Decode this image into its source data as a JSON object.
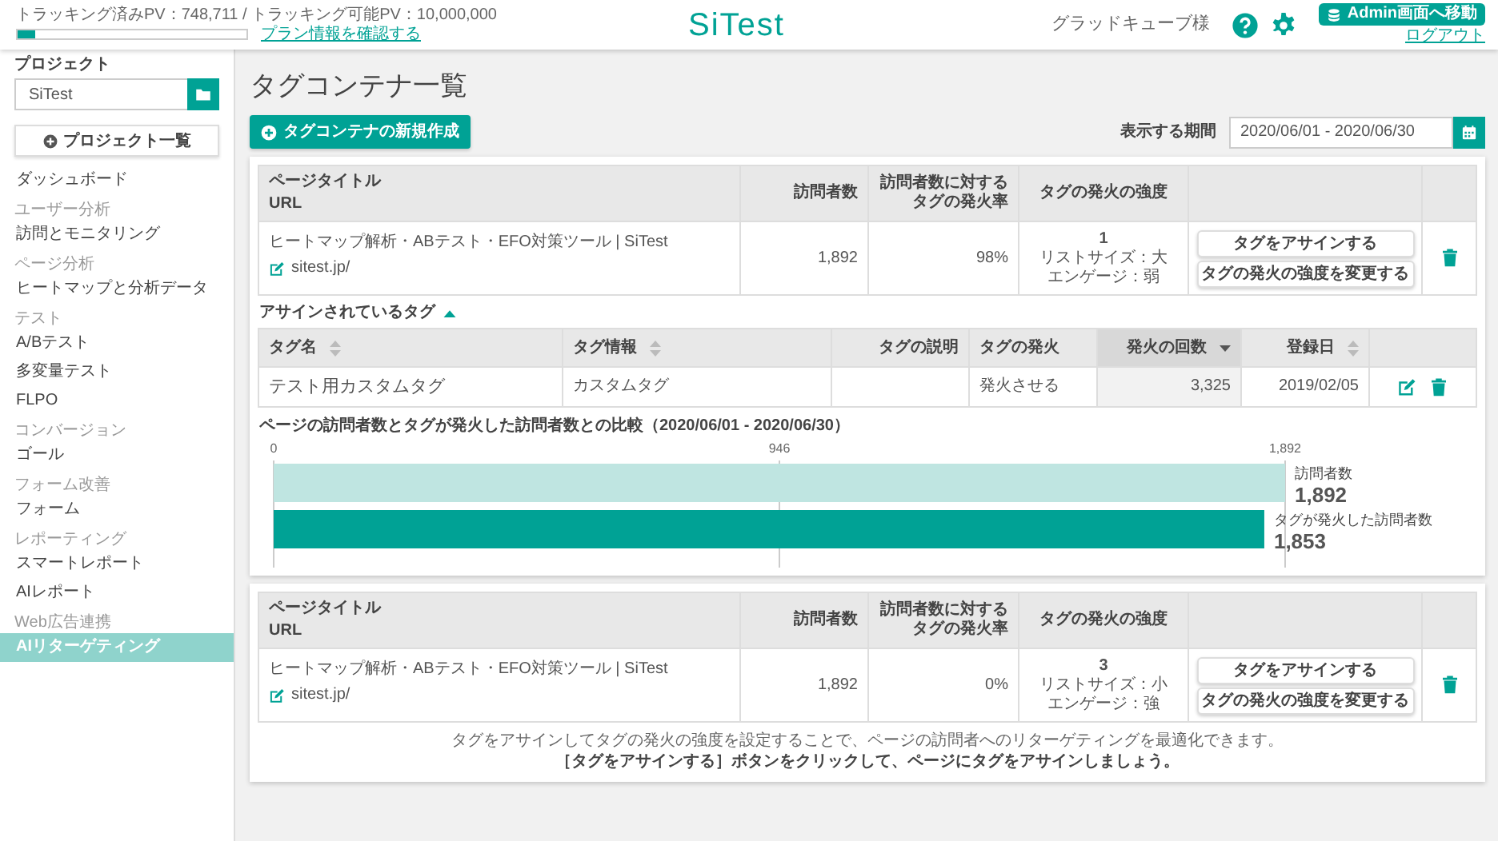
{
  "header": {
    "tracking_text": "トラッキング済みPV：748,711 / トラッキング可能PV：10,000,000",
    "usage": {
      "level": 0.075
    },
    "plan_link": "プラン情報を確認する",
    "logo": "SiTest",
    "user": "グラッドキューブ様",
    "admin_button": "Admin画面へ移動",
    "logout_link": "ログアウト"
  },
  "sidebar": {
    "project_label": "プロジェクト",
    "project_value": "SiTest",
    "project_list_button": "プロジェクト一覧",
    "sections": [
      {
        "items": [
          {
            "label": "ダッシュボード",
            "selected": false
          }
        ]
      },
      {
        "heading": "ユーザー分析",
        "items": [
          {
            "label": "訪問とモニタリング",
            "selected": false
          }
        ]
      },
      {
        "heading": "ページ分析",
        "items": [
          {
            "label": "ヒートマップと分析データ",
            "selected": false
          }
        ]
      },
      {
        "heading": "テスト",
        "items": [
          {
            "label": "A/Bテスト",
            "selected": false
          },
          {
            "label": "多変量テスト",
            "selected": false
          },
          {
            "label": "FLPO",
            "selected": false
          }
        ]
      },
      {
        "heading": "コンバージョン",
        "items": [
          {
            "label": "ゴール",
            "selected": false
          }
        ]
      },
      {
        "heading": "フォーム改善",
        "items": [
          {
            "label": "フォーム",
            "selected": false
          }
        ]
      },
      {
        "heading": "レポーティング",
        "items": [
          {
            "label": "スマートレポート",
            "selected": false
          },
          {
            "label": "AIレポート",
            "selected": false
          }
        ]
      },
      {
        "heading": "Web広告連携",
        "items": [
          {
            "label": "AIリターゲティング",
            "selected": true
          }
        ]
      }
    ]
  },
  "main": {
    "title": "タグコンテナ一覧",
    "new_button": "タグコンテナの新規作成",
    "period_label": "表示する期間",
    "period_value": "2020/06/01 - 2020/06/30",
    "pages": [
      {
        "columns": {
          "title": "ページタイトル",
          "url": "URL",
          "visitors": "訪問者数",
          "rate": [
            "訪問者数に対する",
            "タグの発火率"
          ],
          "strength": "タグの発火の強度"
        },
        "title": "ヒートマップ解析・ABテスト・EFO対策ツール | SiTest",
        "url": "sitest.jp/",
        "visitors": "1,892",
        "rate": "98%",
        "strength": "1",
        "list_size": "リストサイズ：大",
        "engagement": "エンゲージ：弱",
        "assign_button": "タグをアサインする",
        "change_button": "タグの発火の強度を変更する",
        "expanded": true,
        "assigned": {
          "label": "アサインされているタグ",
          "columns": [
            {
              "label": "タグ名",
              "sortable": true,
              "selected": false
            },
            {
              "label": "タグ情報",
              "sortable": true,
              "selected": false
            },
            {
              "label": "タグの説明",
              "sortable": false,
              "selected": false
            },
            {
              "label": "タグの発火",
              "sortable": false,
              "selected": false
            },
            {
              "label": "発火の回数",
              "sortable": true,
              "selected": true
            },
            {
              "label": "登録日",
              "sortable": true,
              "selected": false
            }
          ],
          "tags": [
            {
              "cells": [
                "テスト用カスタムタグ",
                "カスタムタグ",
                "",
                "発火させる",
                "3,325",
                "2019/02/05"
              ]
            }
          ]
        },
        "chart_data": {
          "type": "bar",
          "orientation": "horizontal",
          "stacked": false,
          "title": "ページの訪問者数とタグが発火した訪問者数との比較（2020/06/01 - 2020/06/30）",
          "xlim": [
            0,
            1892
          ],
          "xticks": [
            0,
            946,
            {
              "value": 1892,
              "label": "1,892"
            }
          ],
          "series": [
            {
              "name": "訪問者数",
              "color": "#bfe5e1",
              "values": [
                1892
              ],
              "value_labels": [
                "1,892"
              ]
            },
            {
              "name": "タグが発火した訪問者数",
              "color": "#00a295",
              "values": [
                1853
              ],
              "value_labels": [
                "1,853"
              ]
            }
          ]
        }
      },
      {
        "columns": {
          "title": "ページタイトル",
          "url": "URL",
          "visitors": "訪問者数",
          "rate": [
            "訪問者数に対する",
            "タグの発火率"
          ],
          "strength": "タグの発火の強度"
        },
        "title": "ヒートマップ解析・ABテスト・EFO対策ツール | SiTest",
        "url": "sitest.jp/",
        "visitors": "1,892",
        "rate": "0%",
        "strength": "3",
        "list_size": "リストサイズ：小",
        "engagement": "エンゲージ：強",
        "assign_button": "タグをアサインする",
        "change_button": "タグの発火の強度を変更する",
        "expanded": false,
        "notes": [
          "タグをアサインしてタグの発火の強度を設定することで、ページの訪問者へのリターゲティングを最適化できます。",
          "［タグをアサインする］ボタンをクリックして、ページにタグをアサインしましょう。"
        ]
      }
    ]
  }
}
